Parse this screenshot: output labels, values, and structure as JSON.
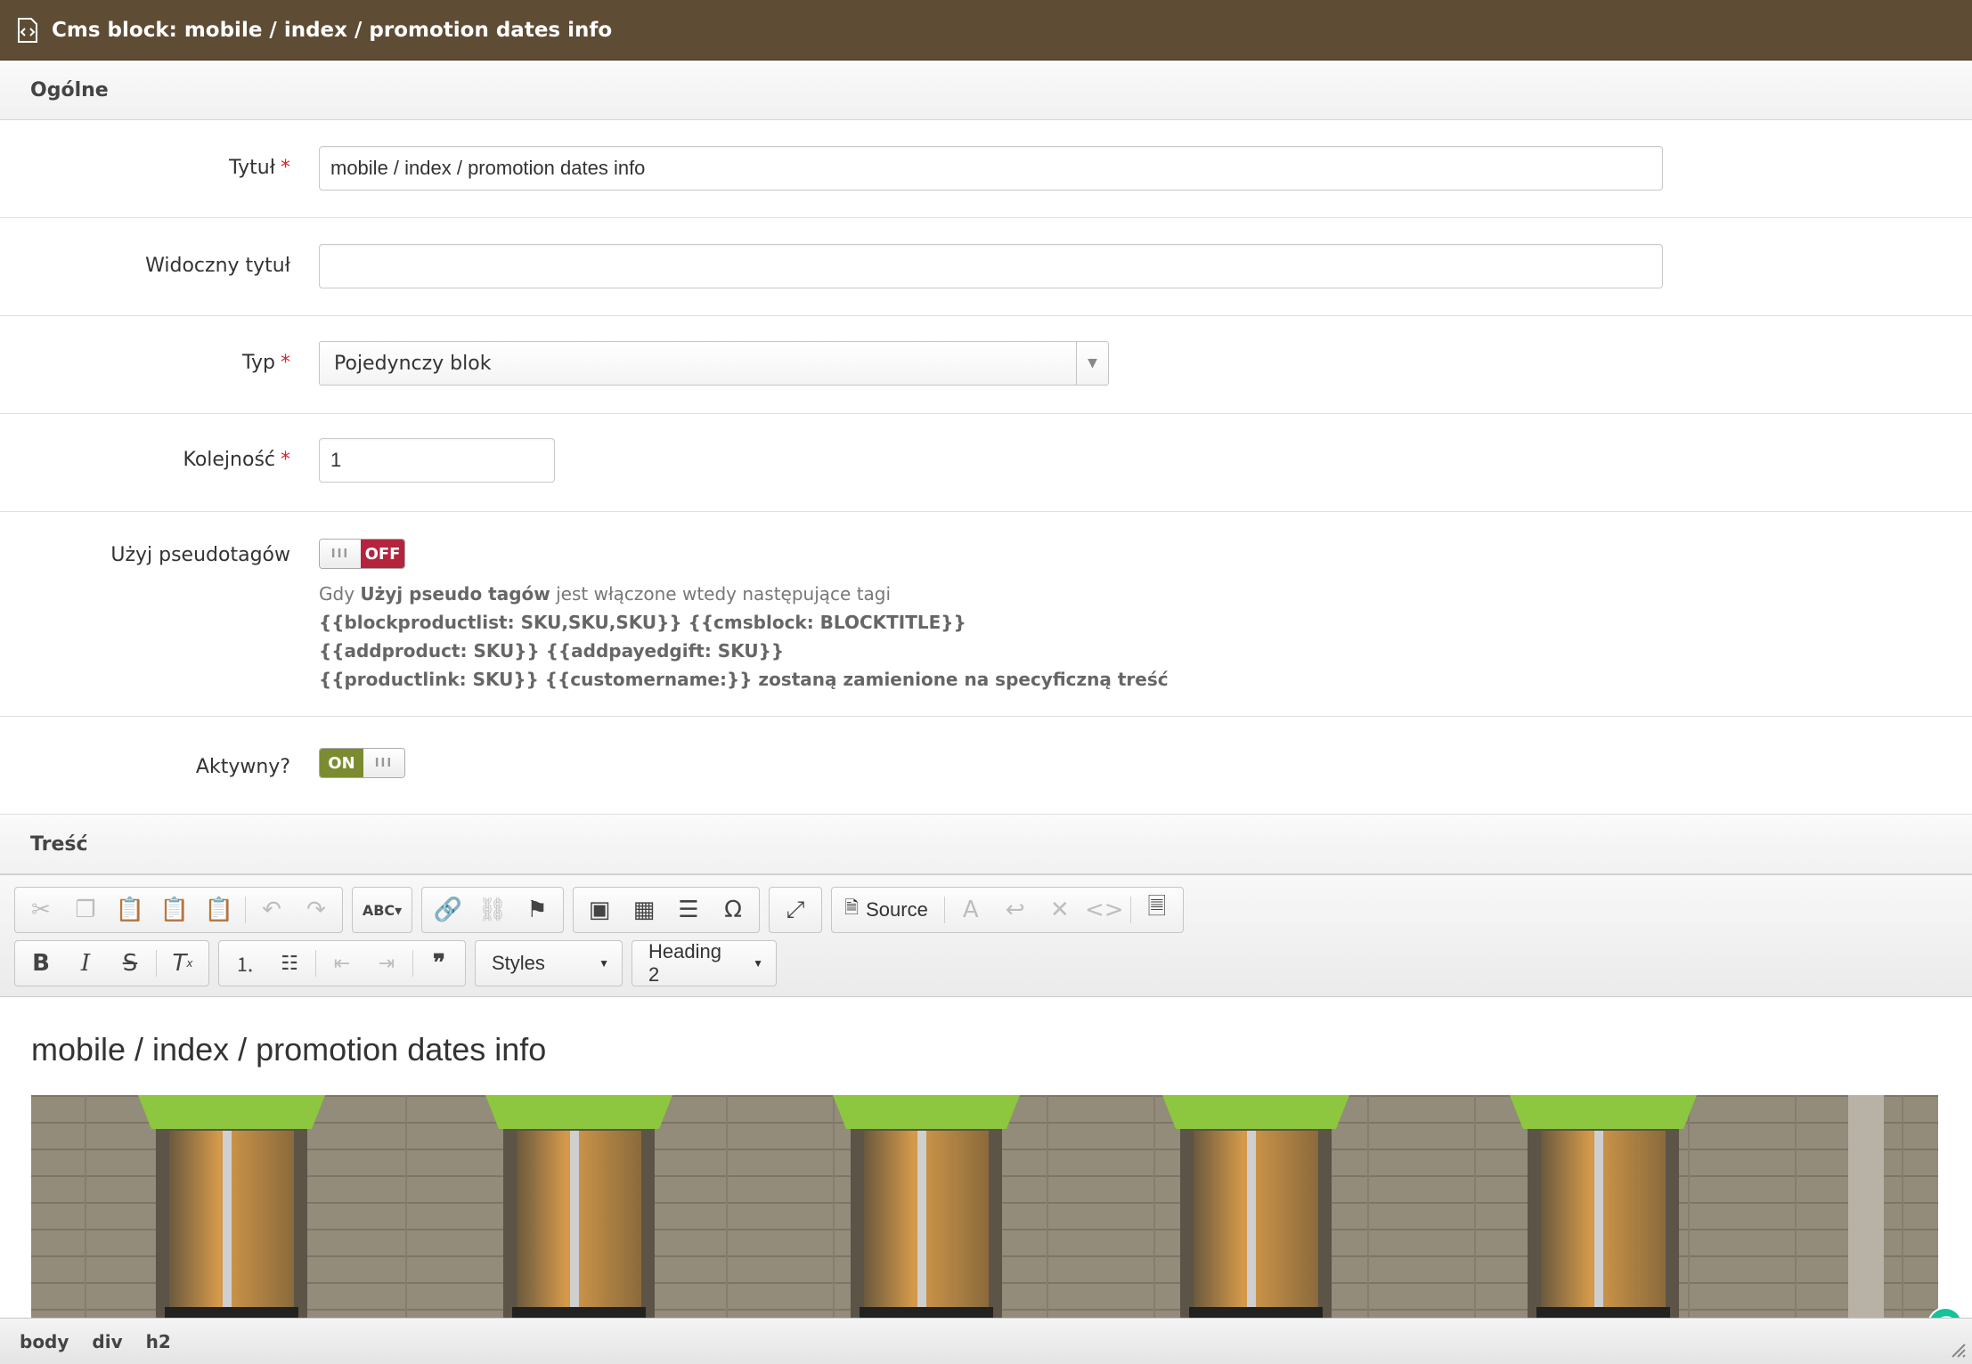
{
  "window": {
    "title": "Cms block: mobile / index / promotion dates info"
  },
  "sections": {
    "general": "Ogólne",
    "content": "Treść"
  },
  "form": {
    "title_label": "Tytuł",
    "title_value": "mobile / index / promotion dates info",
    "visible_title_label": "Widoczny tytuł",
    "visible_title_value": "",
    "type_label": "Typ",
    "type_value": "Pojedynczy blok",
    "order_label": "Kolejność",
    "order_value": "1",
    "pseudotags_label": "Użyj pseudotagów",
    "pseudotags_state": "OFF",
    "help_prefix": "Gdy",
    "help_bold": "Użyj pseudo tagów",
    "help_suffix": "jest włączone wtedy następujące tagi",
    "help_line2": "{{blockproductlist: SKU,SKU,SKU}} {{cmsblock: BLOCKTITLE}}",
    "help_line3": "{{addproduct: SKU}} {{addpayedgift: SKU}}",
    "help_line4": "{{productlink: SKU}} {{customername:}} zostaną zamienione na specyficzną treść",
    "active_label": "Aktywny?",
    "active_state": "ON",
    "required_mark": "*"
  },
  "editor": {
    "source_label": "Source",
    "styles_label": "Styles",
    "format_label": "Heading 2",
    "content_heading": "mobile / index / promotion dates info",
    "statusbar": [
      "body",
      "div",
      "h2"
    ]
  },
  "colors": {
    "titlebar": "#5e4c35",
    "toggle_off": "#b5243f",
    "toggle_on": "#7b8c30",
    "required": "#d9232d"
  }
}
